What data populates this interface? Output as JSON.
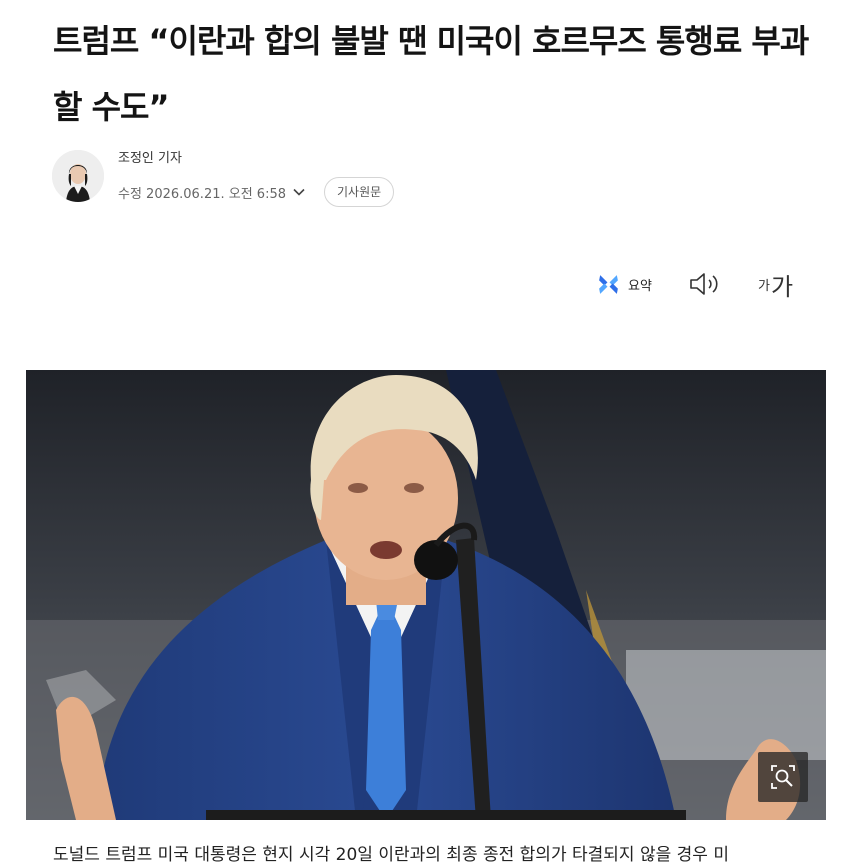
{
  "article": {
    "headline": "트럼프 “이란과 합의 불발 땐 미국이 호르무즈 통행료 부과할 수도”",
    "reporter": "조정인 기자",
    "modified": "수정 2026.06.21. 오전 6:58",
    "original_button": "기사원문",
    "body_preview": "도널드 트럼프 미국 대통령은 현지 시각 20일 이란과의 최종 종전 합의가 타결되지 않을 경우 미"
  },
  "tools": {
    "summary_label": "요약",
    "fontsize_small": "가",
    "fontsize_large": "가"
  },
  "icons": {
    "avatar": "reporter-avatar",
    "chevron": "chevron-down-icon",
    "summary": "summary-sparkle-icon",
    "speaker": "speaker-icon",
    "zoom": "zoom-icon"
  },
  "colors": {
    "summary_icon": "#3b7cf6",
    "suit": "#24407f",
    "tie": "#3d7fd9"
  }
}
